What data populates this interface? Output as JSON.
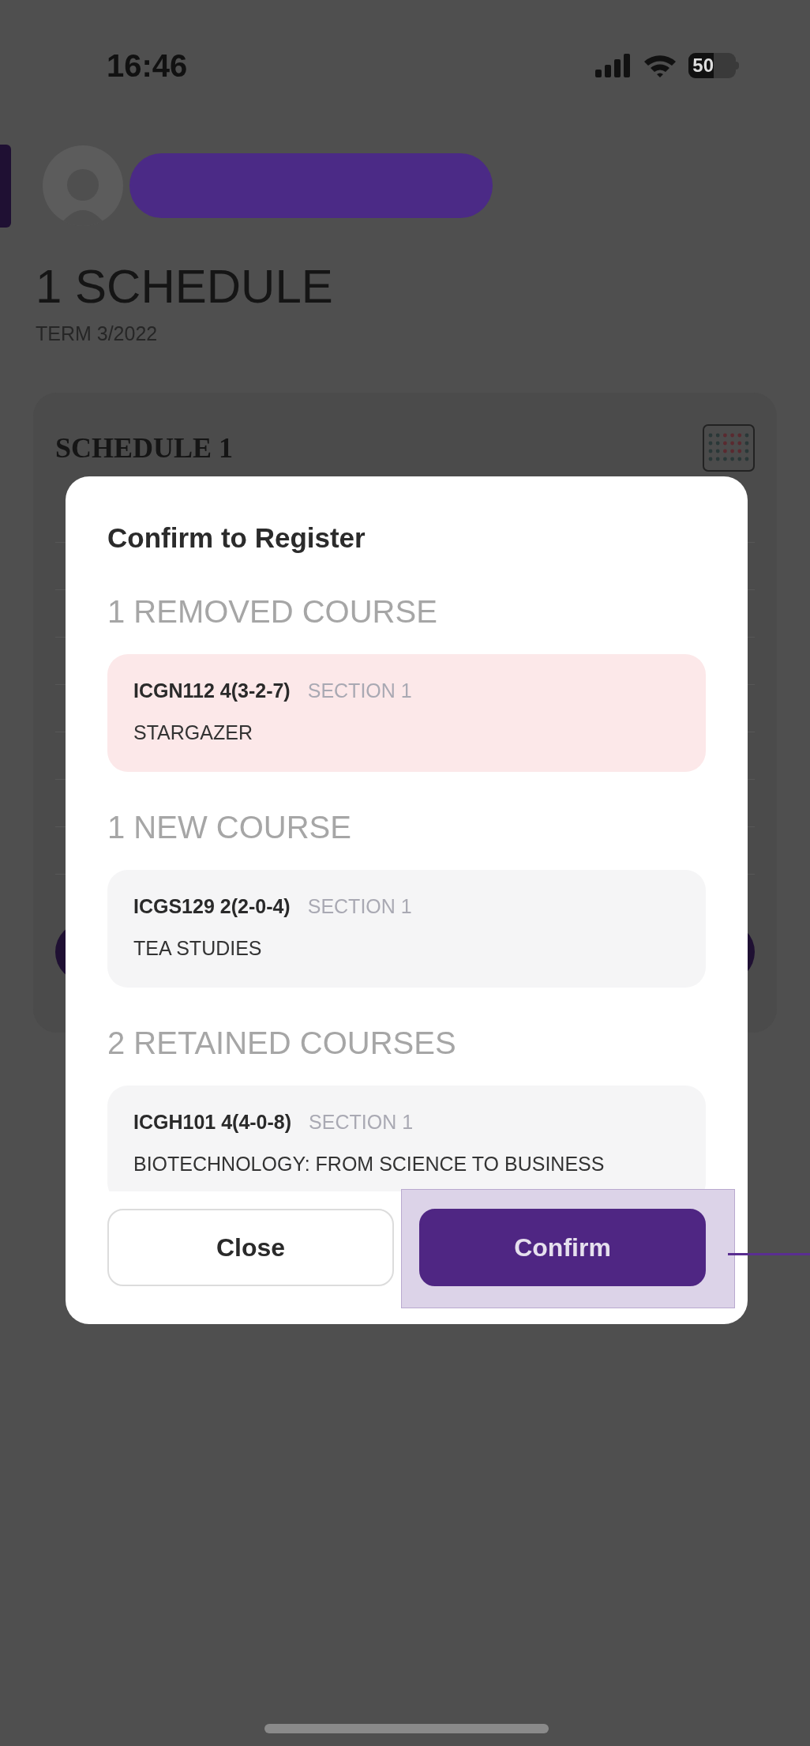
{
  "status_bar": {
    "time": "16:46",
    "battery": "50"
  },
  "page": {
    "title": "1 SCHEDULE",
    "term": "TERM 3/2022",
    "card_title": "SCHEDULE 1"
  },
  "dialog": {
    "title": "Confirm to Register",
    "sections": [
      {
        "kind": "removed",
        "heading": "1 REMOVED COURSE",
        "courses": [
          {
            "code": "ICGN112 4(3-2-7)",
            "section": "SECTION 1",
            "name": "STARGAZER"
          }
        ]
      },
      {
        "kind": "new",
        "heading": "1 NEW COURSE",
        "courses": [
          {
            "code": "ICGS129 2(2-0-4)",
            "section": "SECTION 1",
            "name": "TEA STUDIES"
          }
        ]
      },
      {
        "kind": "retained",
        "heading": "2 RETAINED COURSES",
        "courses": [
          {
            "code": "ICGH101 4(4-0-8)",
            "section": "SECTION 1",
            "name": "BIOTECHNOLOGY: FROM SCIENCE TO BUSINESS"
          }
        ]
      }
    ],
    "buttons": [
      {
        "kind": "secondary",
        "label": "Close",
        "highlighted": false
      },
      {
        "kind": "primary",
        "label": "Confirm",
        "highlighted": true
      }
    ]
  }
}
